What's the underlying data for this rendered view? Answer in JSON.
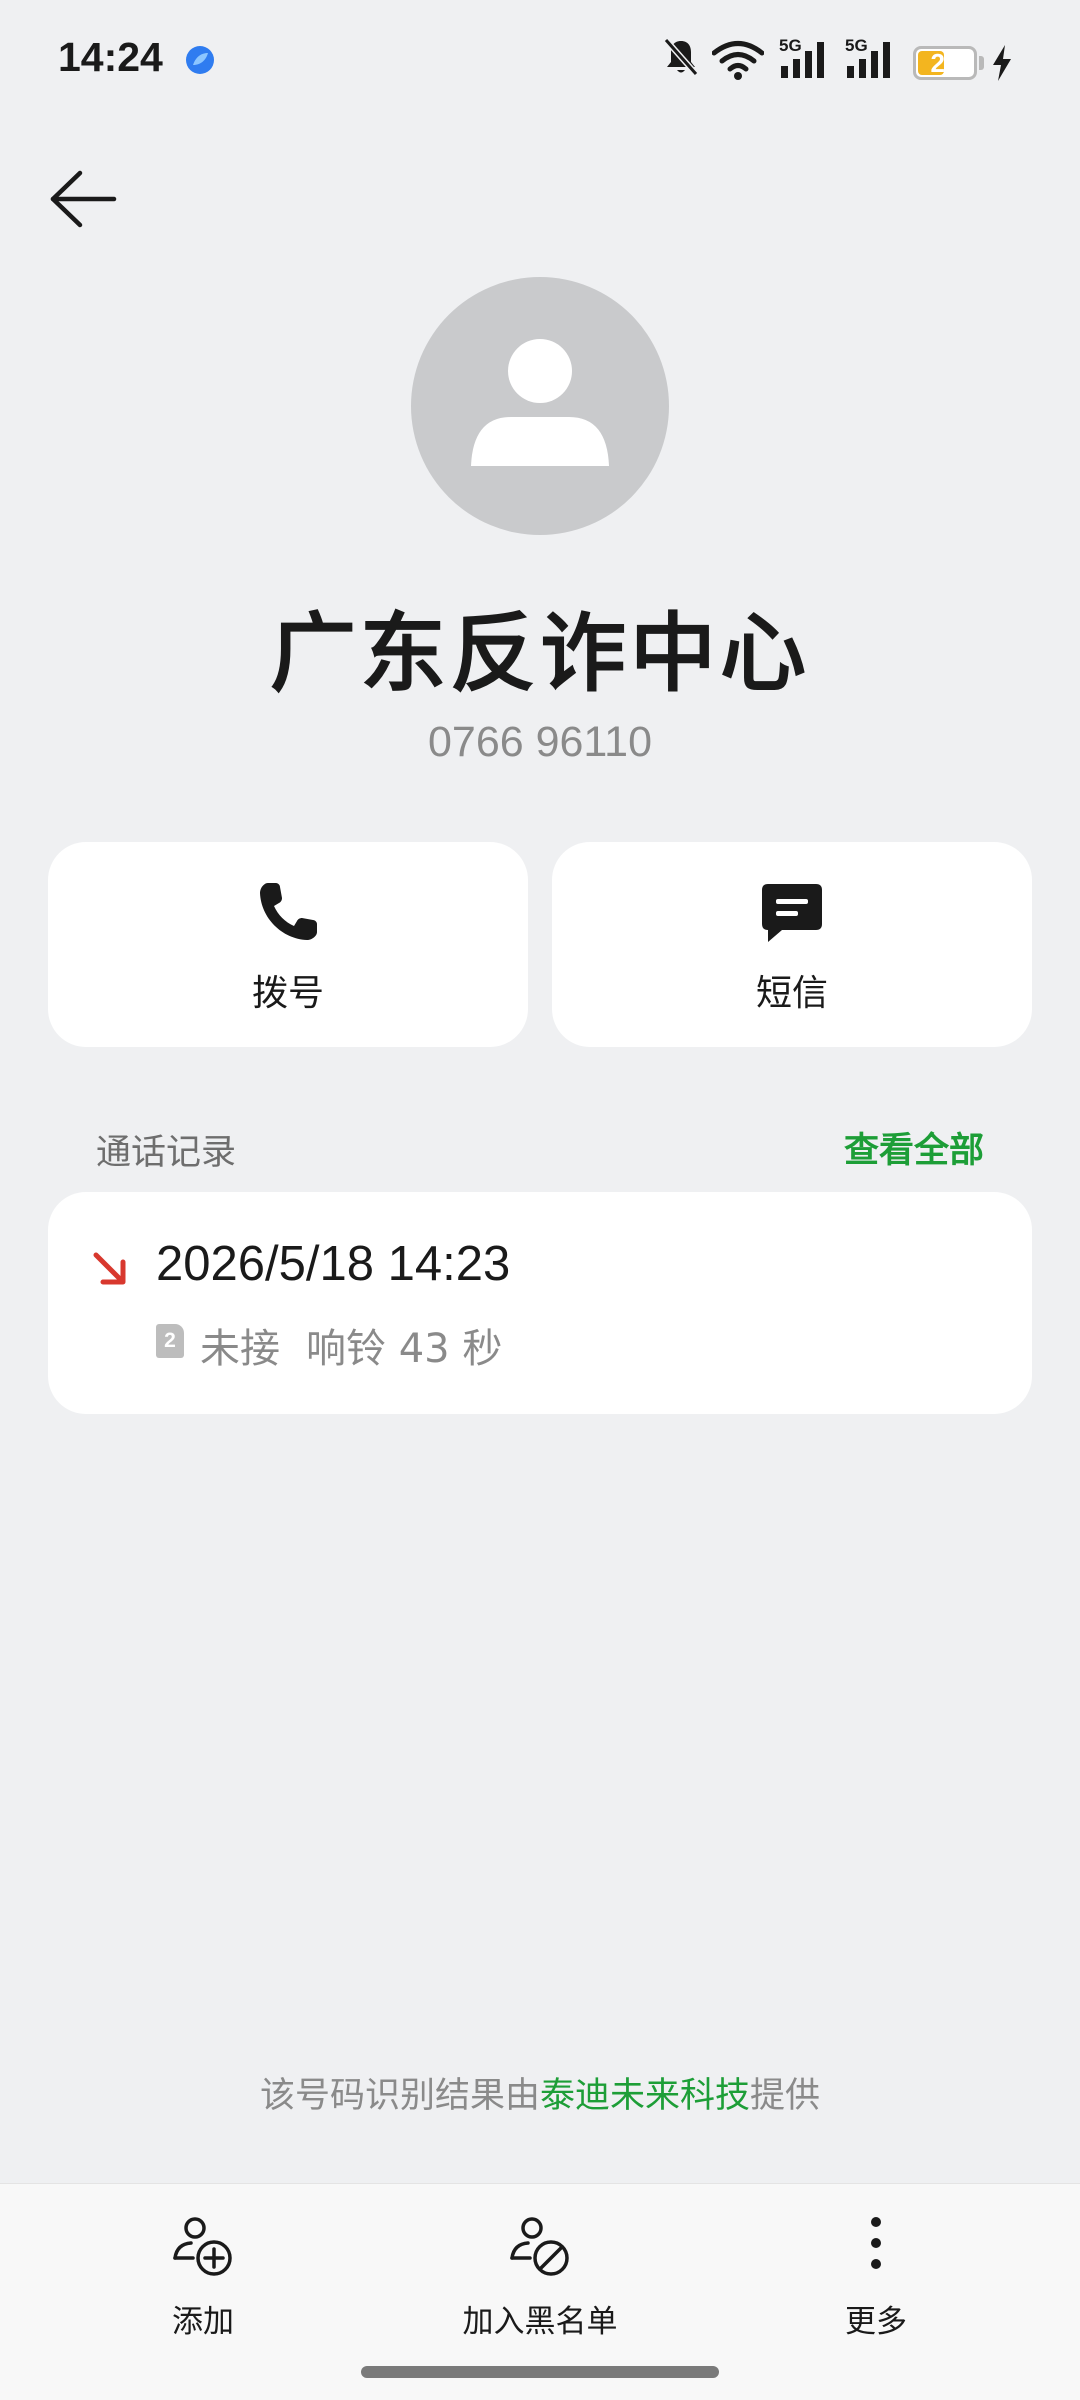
{
  "status_bar": {
    "time": "14:24",
    "battery_level": "23",
    "battery_fraction": 0.23,
    "battery_color": "#f3b51f",
    "network_label_1": "5G",
    "network_label_2": "5G",
    "icons": [
      "app-notification-icon",
      "mute-bell-icon",
      "wifi-icon",
      "signal-5g-icon",
      "signal-5g-icon",
      "battery-icon",
      "charging-icon"
    ]
  },
  "header": {
    "back_icon": "arrow-left-icon"
  },
  "contact": {
    "name": "广东反诈中心",
    "number": "0766 96110",
    "avatar_icon": "person-icon"
  },
  "actions": {
    "dial_label": "拨号",
    "dial_icon": "phone-icon",
    "sms_label": "短信",
    "sms_icon": "message-icon"
  },
  "call_log": {
    "title": "通话记录",
    "view_all": "查看全部",
    "records": [
      {
        "datetime": "2026/5/18 14:23",
        "sim": "2",
        "status": "未接",
        "ring": "响铃 43 秒",
        "direction_icon": "missed-call-icon"
      }
    ]
  },
  "attribution": {
    "prefix": "该号码识别结果由",
    "brand": "泰迪未来科技",
    "suffix": "提供"
  },
  "bottom_bar": {
    "add_label": "添加",
    "add_icon": "add-contact-icon",
    "blacklist_label": "加入黑名单",
    "blacklist_icon": "block-contact-icon",
    "more_label": "更多",
    "more_icon": "more-vertical-icon"
  },
  "colors": {
    "background": "#eff0f2",
    "card": "#ffffff",
    "accent_green": "#1d9e37",
    "missed_red": "#d8382e"
  }
}
